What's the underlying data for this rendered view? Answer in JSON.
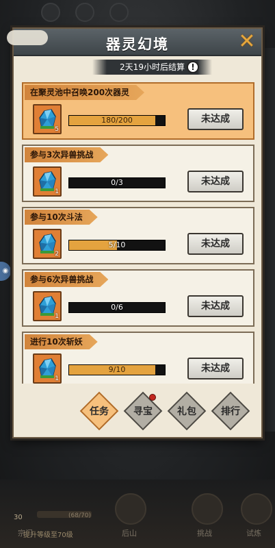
{
  "panel": {
    "title": "器灵幻境",
    "timer": "2天19小时后结算",
    "info_symbol": "!",
    "close_symbol": "✕"
  },
  "tasks": [
    {
      "title": "在聚灵池中召唤200次器灵",
      "item_count": "5",
      "progress_text": "180/200",
      "progress_fraction": 0.9,
      "status": "未达成",
      "highlight": true
    },
    {
      "title": "参与3次异兽挑战",
      "item_count": "1",
      "progress_text": "0/3",
      "progress_fraction": 0.0,
      "status": "未达成",
      "highlight": false
    },
    {
      "title": "参与10次斗法",
      "item_count": "2",
      "progress_text": "5/10",
      "progress_fraction": 0.5,
      "status": "未达成",
      "highlight": false
    },
    {
      "title": "参与6次异兽挑战",
      "item_count": "1",
      "progress_text": "0/6",
      "progress_fraction": 0.0,
      "status": "未达成",
      "highlight": false
    },
    {
      "title": "进行10次斩妖",
      "item_count": "1",
      "progress_text": "9/10",
      "progress_fraction": 0.9,
      "status": "未达成",
      "highlight": false
    }
  ],
  "tabs": [
    {
      "label": "任务",
      "active": true
    },
    {
      "label": "寻宝",
      "active": false,
      "badge": true
    },
    {
      "label": "礼包",
      "active": false
    },
    {
      "label": "排行",
      "active": false
    }
  ],
  "background": {
    "level": "30",
    "level_progress": "(68/70)",
    "level_hint": "提升等级至70级",
    "nav": [
      "宗门",
      "后山",
      "挑战",
      "试炼"
    ]
  },
  "colors": {
    "accent": "#e4a33f",
    "highlight_row": "#f6c07d",
    "panel_bg": "#efe8d8",
    "title_bar": "#4b5256"
  },
  "icons": {
    "task_item": "crystal-icon"
  }
}
